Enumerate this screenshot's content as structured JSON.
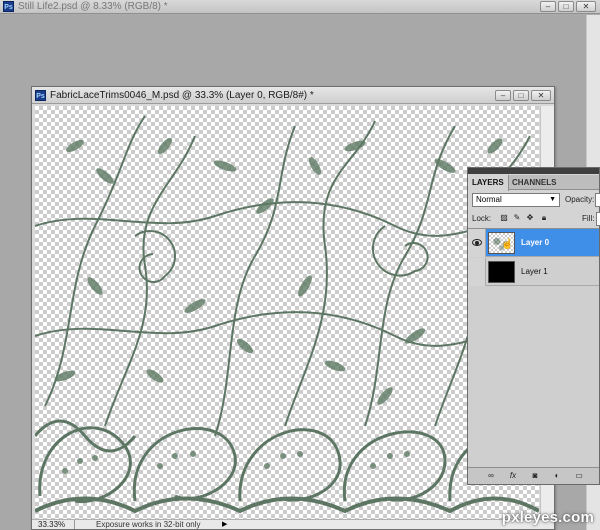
{
  "outer_window": {
    "title": "Still Life2.psd @ 8.33% (RGB/8) *",
    "app_badge": "Ps"
  },
  "document_window": {
    "title": "FabricLaceTrims0046_M.psd @ 33.3% (Layer 0, RGB/8#) *",
    "app_badge": "Ps",
    "status": {
      "zoom": "33.33%",
      "message": "Exposure works in 32-bit only"
    }
  },
  "window_buttons": {
    "minimize": "–",
    "restore": "□",
    "close": "✕"
  },
  "layers_panel": {
    "tabs": [
      {
        "label": "LAYERS",
        "active": true
      },
      {
        "label": "CHANNELS",
        "active": false
      }
    ],
    "blend_mode": "Normal",
    "opacity_label": "Opacity:",
    "lock_label": "Lock:",
    "fill_label": "Fill:",
    "layers": [
      {
        "name": "Layer 0",
        "selected": true,
        "visible": true,
        "thumbnail": "lace"
      },
      {
        "name": "Layer 1",
        "selected": false,
        "visible": false,
        "thumbnail": "black"
      }
    ],
    "bottom_icons": [
      "link-icon",
      "fx-icon",
      "mask-icon",
      "adjustment-icon",
      "folder-icon"
    ]
  },
  "watermark": "pxleyes.com",
  "colors": {
    "selection": "#3f8ee8",
    "lace": "#5e7a64",
    "workspace": "#ababab"
  }
}
